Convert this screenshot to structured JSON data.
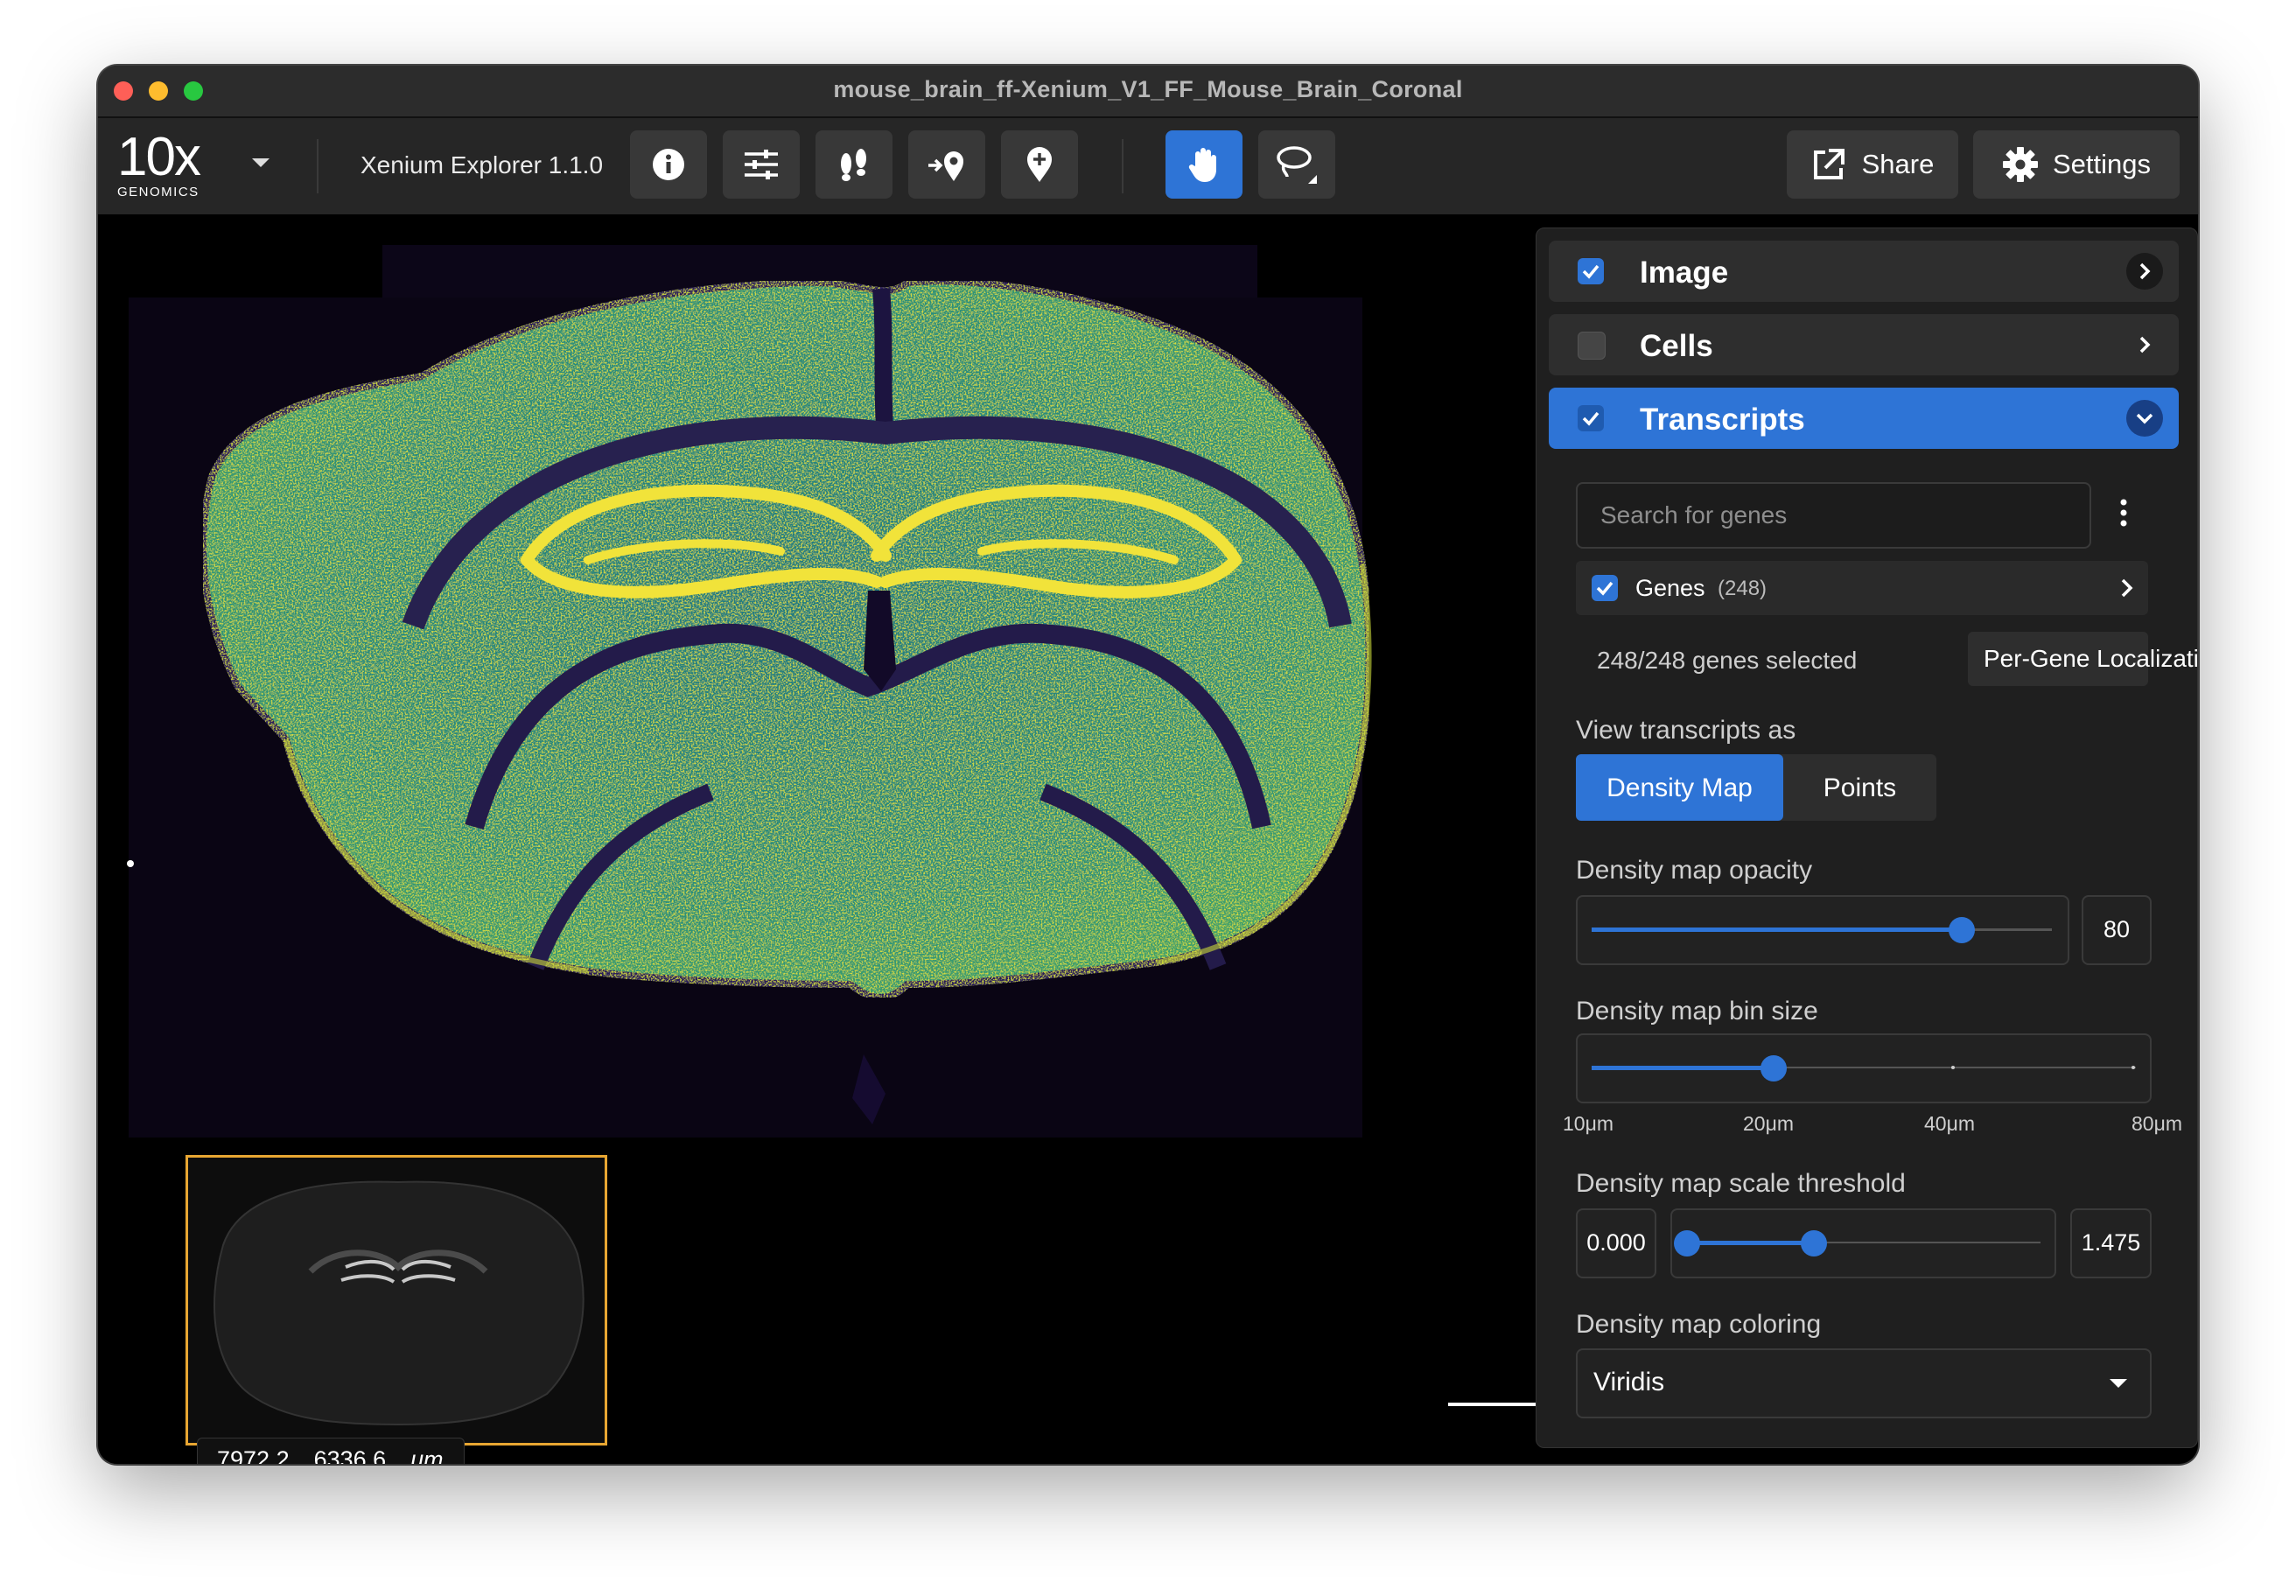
{
  "window": {
    "title": "mouse_brain_ff-Xenium_V1_FF_Mouse_Brain_Coronal"
  },
  "toolbar": {
    "logo": {
      "main": "10x",
      "sub": "GENOMICS"
    },
    "app_name": "Xenium Explorer 1.1.0",
    "share_label": "Share",
    "settings_label": "Settings",
    "icons": [
      "info-icon",
      "sliders-icon",
      "footprints-icon",
      "add-location-icon",
      "location-pin-icon",
      "hand-icon",
      "lasso-icon",
      "share-icon",
      "gear-icon"
    ]
  },
  "layers": {
    "image": {
      "label": "Image",
      "checked": true
    },
    "cells": {
      "label": "Cells",
      "checked": false
    },
    "transcripts": {
      "label": "Transcripts",
      "checked": true
    }
  },
  "transcripts": {
    "search_placeholder": "Search for genes",
    "genes_label": "Genes",
    "genes_count": "(248)",
    "selected_text": "248/248 genes selected",
    "per_gene_button": "Per-Gene Localization",
    "view_as_label": "View transcripts as",
    "view_options": [
      "Density Map",
      "Points"
    ],
    "view_selected": "Density Map",
    "opacity_label": "Density map opacity",
    "opacity_value": "80",
    "bin_label": "Density map bin size",
    "bin_ticks": [
      "10μm",
      "20μm",
      "40μm",
      "80μm"
    ],
    "bin_selected": "20μm",
    "threshold_label": "Density map scale threshold",
    "threshold_min": "0.000",
    "threshold_max": "1.475",
    "coloring_label": "Density map coloring",
    "coloring_value": "Viridis"
  },
  "minimap": {
    "x": "7972.2",
    "y": "6336.6",
    "unit": "μm"
  },
  "colors": {
    "accent": "#2e74d6",
    "viridis_dark": "#440154",
    "viridis_mid": "#21918c",
    "viridis_bright": "#fde725",
    "minimap_border": "#e8a632"
  }
}
